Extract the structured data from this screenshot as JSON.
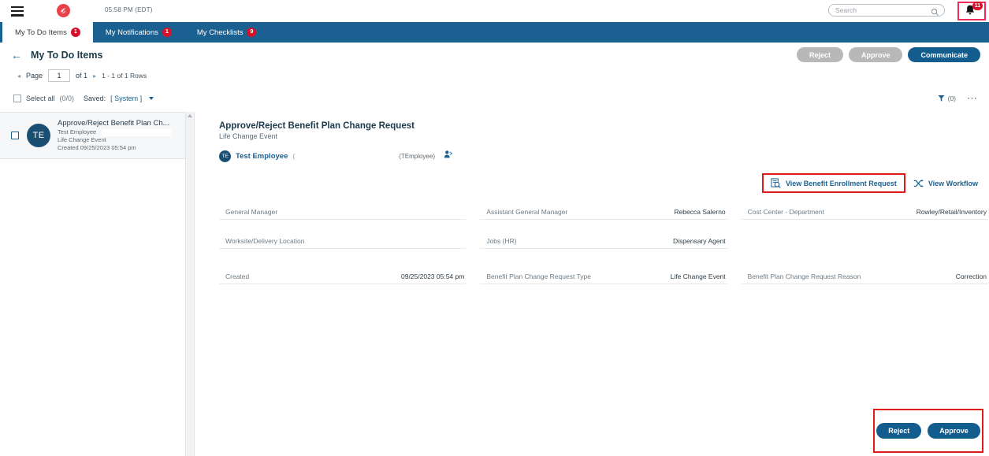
{
  "topbar": {
    "menu_icon": "hamburger-menu-icon",
    "logo_icon": "brand-logo-icon",
    "clock": "05:58 PM (EDT)",
    "search_placeholder": "Search",
    "search_value": "",
    "search_icon": "search-icon",
    "bell_icon": "notification-bell-icon",
    "bell_badge": "11"
  },
  "tabs": [
    {
      "label": "My To Do Items",
      "badge": "1",
      "active": true
    },
    {
      "label": "My Notifications",
      "badge": "1",
      "active": false
    },
    {
      "label": "My Checklists",
      "badge": "9",
      "active": false
    }
  ],
  "page": {
    "back_icon": "back-arrow-icon",
    "title": "My To Do Items"
  },
  "header_actions": {
    "reject": "Reject",
    "approve": "Approve",
    "communicate": "Communicate"
  },
  "pager": {
    "prev_icon": "chevron-left-icon",
    "next_icon": "chevron-right-icon",
    "page_label": "Page",
    "page_value": "1",
    "of_label": "of 1",
    "rows_label": "1 - 1 of 1 Rows"
  },
  "toolbar": {
    "select_all_label": "Select all",
    "select_all_count": "(0/0)",
    "saved_label": "Saved:",
    "saved_value": "[ System ]",
    "filter_icon": "filter-funnel-icon",
    "filter_count": "(0)",
    "more_icon": "more-options-icon"
  },
  "list": {
    "items": [
      {
        "avatar_initials": "TE",
        "title": "Approve/Reject Benefit Plan Ch...",
        "employee": "Test Employee",
        "event": "Life Change Event",
        "created": "Created 09/25/2023 05:54 pm"
      }
    ]
  },
  "detail": {
    "title": "Approve/Reject Benefit Plan Change Request",
    "subtitle": "Life Change Event",
    "requester": {
      "avatar_initials": "TE",
      "name": "Test Employee",
      "paren": "(",
      "user_id": "(TEmployee)",
      "person_icon": "person-badge-icon"
    },
    "links": {
      "view_enrollment_icon": "document-search-icon",
      "view_enrollment": "View Benefit Enrollment Request",
      "view_workflow_icon": "workflow-shuffle-icon",
      "view_workflow": "View Workflow"
    },
    "fields": [
      [
        {
          "label": "General Manager",
          "value": ""
        },
        {
          "label": "Assistant General Manager",
          "value": "Rebecca Salerno"
        },
        {
          "label": "Cost Center - Department",
          "value": "Rowley/Retail/Inventory"
        }
      ],
      [
        {
          "label": "Worksite/Delivery Location",
          "value": ""
        },
        {
          "label": "Jobs (HR)",
          "value": "Dispensary Agent"
        },
        {
          "label": "",
          "value": ""
        }
      ],
      [
        {
          "label": "Created",
          "value": "09/25/2023 05:54 pm"
        },
        {
          "label": "Benefit Plan Change Request Type",
          "value": "Life Change Event"
        },
        {
          "label": "Benefit Plan Change Request Reason",
          "value": "Correction"
        }
      ]
    ]
  },
  "footer_actions": {
    "reject": "Reject",
    "approve": "Approve"
  },
  "colors": {
    "tabbar_blue": "#1a6191",
    "button_blue": "#125c8e",
    "badge_red": "#d8112a",
    "highlight_red": "#e01919",
    "avatar_navy": "#1b4f72"
  }
}
